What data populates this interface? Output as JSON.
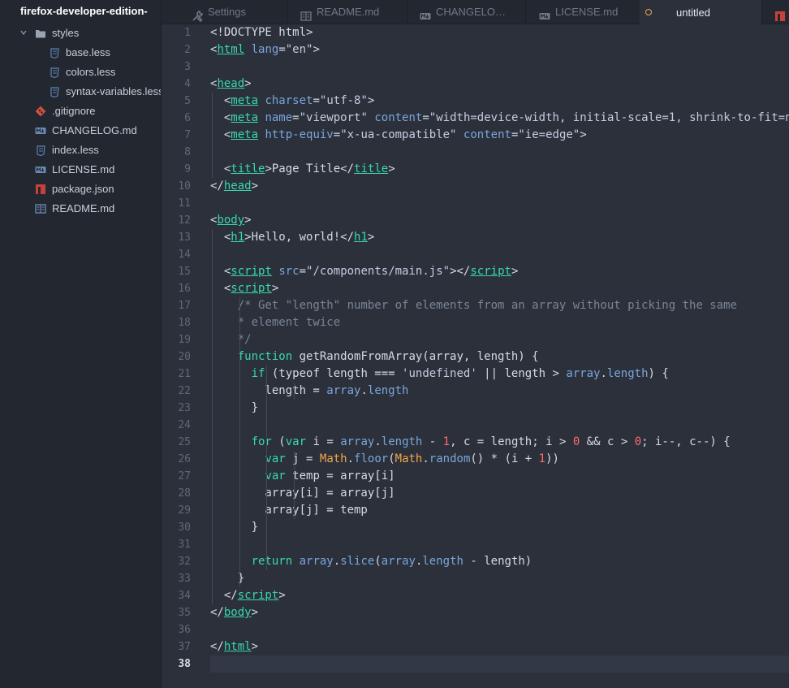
{
  "sidebar": {
    "project": "firefox-developer-edition-",
    "folder": {
      "name": "styles",
      "icon": "folder-icon"
    },
    "items": [
      {
        "name": "base.less",
        "icon": "css-file-icon",
        "level": 2
      },
      {
        "name": "colors.less",
        "icon": "css-file-icon",
        "level": 2
      },
      {
        "name": "syntax-variables.less",
        "icon": "css-file-icon",
        "level": 2
      },
      {
        "name": ".gitignore",
        "icon": "git-icon",
        "level": 1
      },
      {
        "name": "CHANGELOG.md",
        "icon": "markdown-icon",
        "level": 1
      },
      {
        "name": "index.less",
        "icon": "css-file-icon",
        "level": 1
      },
      {
        "name": "LICENSE.md",
        "icon": "markdown-icon",
        "level": 1
      },
      {
        "name": "package.json",
        "icon": "npm-icon",
        "level": 1
      },
      {
        "name": "README.md",
        "icon": "book-icon",
        "level": 1
      }
    ]
  },
  "tabs": [
    {
      "label": "Settings",
      "icon": "tools-icon"
    },
    {
      "label": "README.md",
      "icon": "book-icon"
    },
    {
      "label": "CHANGELO…",
      "icon": "markdown-icon"
    },
    {
      "label": "LICENSE.md",
      "icon": "markdown-icon"
    },
    {
      "label": "untitled",
      "icon": "modified-dot-icon",
      "active": true
    },
    {
      "label": "",
      "icon": "npm-icon"
    }
  ],
  "editor": {
    "current_line": 38,
    "line_numbers": [
      "1",
      "2",
      "3",
      "4",
      "5",
      "6",
      "7",
      "8",
      "9",
      "10",
      "11",
      "12",
      "13",
      "14",
      "15",
      "16",
      "17",
      "18",
      "19",
      "20",
      "21",
      "22",
      "23",
      "24",
      "25",
      "26",
      "27",
      "28",
      "29",
      "30",
      "31",
      "32",
      "33",
      "34",
      "35",
      "36",
      "37",
      "38"
    ],
    "lines": [
      [
        [
          "pl",
          "<!DOCTYPE html>"
        ]
      ],
      [
        [
          "pl",
          "<"
        ],
        [
          "tg",
          "html"
        ],
        [
          "pl",
          " "
        ],
        [
          "at",
          "lang"
        ],
        [
          "pl",
          "="
        ],
        [
          "st",
          "\"en\""
        ],
        [
          "pl",
          ">"
        ]
      ],
      [],
      [
        [
          "pl",
          "<"
        ],
        [
          "tg",
          "head"
        ],
        [
          "pl",
          ">"
        ]
      ],
      [
        [
          "pl",
          "  <"
        ],
        [
          "tg",
          "meta"
        ],
        [
          "pl",
          " "
        ],
        [
          "at",
          "charset"
        ],
        [
          "pl",
          "="
        ],
        [
          "st",
          "\"utf-8\""
        ],
        [
          "pl",
          ">"
        ]
      ],
      [
        [
          "pl",
          "  <"
        ],
        [
          "tg",
          "meta"
        ],
        [
          "pl",
          " "
        ],
        [
          "at",
          "name"
        ],
        [
          "pl",
          "="
        ],
        [
          "st",
          "\"viewport\""
        ],
        [
          "pl",
          " "
        ],
        [
          "at",
          "content"
        ],
        [
          "pl",
          "="
        ],
        [
          "st",
          "\"width=device-width, initial-scale=1, shrink-to-fit=n"
        ]
      ],
      [
        [
          "pl",
          "  <"
        ],
        [
          "tg",
          "meta"
        ],
        [
          "pl",
          " "
        ],
        [
          "at",
          "http-equiv"
        ],
        [
          "pl",
          "="
        ],
        [
          "st",
          "\"x-ua-compatible\""
        ],
        [
          "pl",
          " "
        ],
        [
          "at",
          "content"
        ],
        [
          "pl",
          "="
        ],
        [
          "st",
          "\"ie=edge\""
        ],
        [
          "pl",
          ">"
        ]
      ],
      [],
      [
        [
          "pl",
          "  <"
        ],
        [
          "tg",
          "title"
        ],
        [
          "pl",
          ">Page Title</"
        ],
        [
          "tg",
          "title"
        ],
        [
          "pl",
          ">"
        ]
      ],
      [
        [
          "pl",
          "</"
        ],
        [
          "tg",
          "head"
        ],
        [
          "pl",
          ">"
        ]
      ],
      [],
      [
        [
          "pl",
          "<"
        ],
        [
          "tg",
          "body"
        ],
        [
          "pl",
          ">"
        ]
      ],
      [
        [
          "pl",
          "  <"
        ],
        [
          "tg",
          "h1"
        ],
        [
          "pl",
          ">Hello, world!</"
        ],
        [
          "tg",
          "h1"
        ],
        [
          "pl",
          ">"
        ]
      ],
      [],
      [
        [
          "pl",
          "  <"
        ],
        [
          "tg",
          "script"
        ],
        [
          "pl",
          " "
        ],
        [
          "at",
          "src"
        ],
        [
          "pl",
          "="
        ],
        [
          "st",
          "\"/components/main.js\""
        ],
        [
          "pl",
          "></"
        ],
        [
          "tg",
          "script"
        ],
        [
          "pl",
          ">"
        ]
      ],
      [
        [
          "pl",
          "  <"
        ],
        [
          "tg",
          "script"
        ],
        [
          "pl",
          ">"
        ]
      ],
      [
        [
          "cm",
          "    /* Get \"length\" number of elements from an array without picking the same"
        ]
      ],
      [
        [
          "cm",
          "    * element twice"
        ]
      ],
      [
        [
          "cm",
          "    */"
        ]
      ],
      [
        [
          "pl",
          "    "
        ],
        [
          "kw",
          "function"
        ],
        [
          "pl",
          " getRandomFromArray(array, length) {"
        ]
      ],
      [
        [
          "pl",
          "      "
        ],
        [
          "kw",
          "if"
        ],
        [
          "pl",
          " (typeof length "
        ],
        [
          "pl",
          "==="
        ],
        [
          "pl",
          " "
        ],
        [
          "st",
          "'undefined'"
        ],
        [
          "pl",
          " || length > "
        ],
        [
          "pr",
          "array"
        ],
        [
          "pl",
          "."
        ],
        [
          "pr",
          "length"
        ],
        [
          "pl",
          ") {"
        ]
      ],
      [
        [
          "pl",
          "        length = "
        ],
        [
          "pr",
          "array"
        ],
        [
          "pl",
          "."
        ],
        [
          "pr",
          "length"
        ]
      ],
      [
        [
          "pl",
          "      }"
        ]
      ],
      [],
      [
        [
          "pl",
          "      "
        ],
        [
          "kw",
          "for"
        ],
        [
          "pl",
          " ("
        ],
        [
          "kw",
          "var"
        ],
        [
          "pl",
          " i = "
        ],
        [
          "pr",
          "array"
        ],
        [
          "pl",
          "."
        ],
        [
          "pr",
          "length"
        ],
        [
          "pl",
          " - "
        ],
        [
          "nm",
          "1"
        ],
        [
          "pl",
          ", c = length; i > "
        ],
        [
          "nm",
          "0"
        ],
        [
          "pl",
          " && c > "
        ],
        [
          "nm",
          "0"
        ],
        [
          "pl",
          "; i--, c--) {"
        ]
      ],
      [
        [
          "pl",
          "        "
        ],
        [
          "kw",
          "var"
        ],
        [
          "pl",
          " j = "
        ],
        [
          "ob",
          "Math"
        ],
        [
          "pl",
          "."
        ],
        [
          "pr",
          "floor"
        ],
        [
          "pl",
          "("
        ],
        [
          "ob",
          "Math"
        ],
        [
          "pl",
          "."
        ],
        [
          "pr",
          "random"
        ],
        [
          "pl",
          "() * (i + "
        ],
        [
          "nm",
          "1"
        ],
        [
          "pl",
          "))"
        ]
      ],
      [
        [
          "pl",
          "        "
        ],
        [
          "kw",
          "var"
        ],
        [
          "pl",
          " temp = array[i]"
        ]
      ],
      [
        [
          "pl",
          "        array[i] = array[j]"
        ]
      ],
      [
        [
          "pl",
          "        array[j] = temp"
        ]
      ],
      [
        [
          "pl",
          "      }"
        ]
      ],
      [],
      [
        [
          "pl",
          "      "
        ],
        [
          "kw",
          "return"
        ],
        [
          "pl",
          " "
        ],
        [
          "pr",
          "array"
        ],
        [
          "pl",
          "."
        ],
        [
          "pr",
          "slice"
        ],
        [
          "pl",
          "("
        ],
        [
          "pr",
          "array"
        ],
        [
          "pl",
          "."
        ],
        [
          "pr",
          "length"
        ],
        [
          "pl",
          " - length)"
        ]
      ],
      [
        [
          "pl",
          "    }"
        ]
      ],
      [
        [
          "pl",
          "  </"
        ],
        [
          "tg",
          "script"
        ],
        [
          "pl",
          ">"
        ]
      ],
      [
        [
          "pl",
          "</"
        ],
        [
          "tg",
          "body"
        ],
        [
          "pl",
          ">"
        ]
      ],
      [],
      [
        [
          "pl",
          "</"
        ],
        [
          "tg",
          "html"
        ],
        [
          "pl",
          ">"
        ]
      ],
      []
    ]
  }
}
